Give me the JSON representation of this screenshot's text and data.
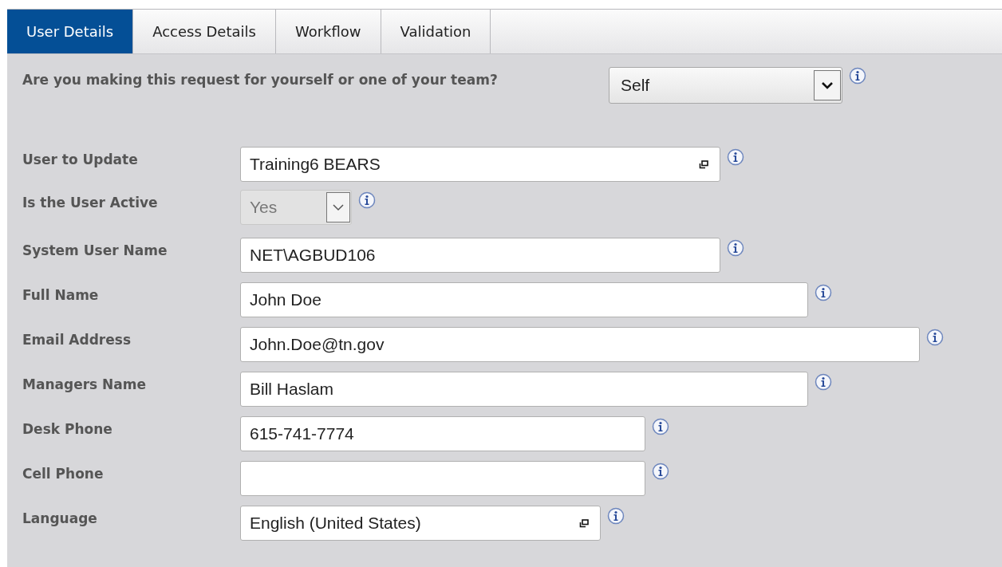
{
  "tabs": [
    {
      "label": "User Details",
      "selected": true
    },
    {
      "label": "Access Details",
      "selected": false
    },
    {
      "label": "Workflow",
      "selected": false
    },
    {
      "label": "Validation",
      "selected": false
    }
  ],
  "question": {
    "label": "Are you making this request for yourself or one of your team?",
    "value": "Self"
  },
  "fields": [
    {
      "label": "User to Update",
      "kind": "lookup",
      "value": "Training6 BEARS"
    },
    {
      "label": "Is the User Active",
      "kind": "select",
      "value": "Yes",
      "disabled": true
    },
    {
      "label": "System User Name",
      "kind": "text",
      "value": "NET\\AGBUD106"
    },
    {
      "label": "Full Name",
      "kind": "text",
      "value": "John Doe"
    },
    {
      "label": "Email Address",
      "kind": "text",
      "value": "John.Doe@tn.gov"
    },
    {
      "label": "Managers Name",
      "kind": "text",
      "value": "Bill Haslam"
    },
    {
      "label": "Desk Phone",
      "kind": "text",
      "value": "615-741-7774"
    },
    {
      "label": "Cell Phone",
      "kind": "text"
    },
    {
      "label": "Language",
      "kind": "lookup",
      "value": "English (United States)"
    }
  ]
}
